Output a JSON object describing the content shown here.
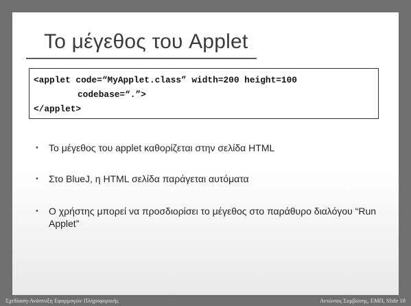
{
  "slide": {
    "title": "Το μέγεθος του Applet",
    "code": [
      "<applet code=“MyApplet.class” width=200 height=100",
      "codebase=“.”>",
      "</applet>"
    ],
    "bullets": [
      "Το μέγεθος του applet καθορίζεται στην σελίδα  HTML",
      "Στο BlueJ, η HTML σελίδα παράγεται αυτόματα",
      "Ο χρήστης μπορεί να προσδιορίσει το μέγεθος στο παράθυρο διαλόγου “Run Applet”"
    ],
    "bullet_glyph": "•"
  },
  "footer": {
    "left": "Σχεδίαση-Ανάπτυξη Εφαρμογών Πληροφορικής",
    "right": "Αντώνιος Συμβώνης, ΕΜΠ, Slide 18"
  }
}
